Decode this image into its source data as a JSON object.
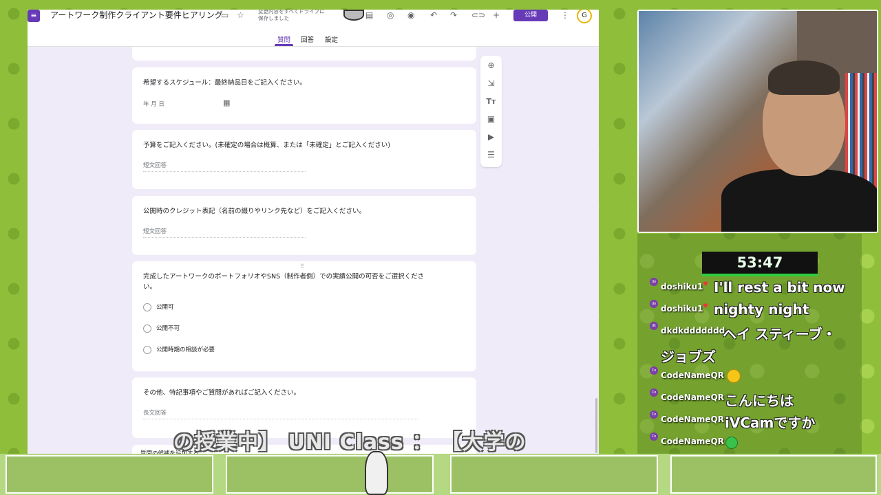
{
  "forms": {
    "title": "アートワーク制作クライアント要件ヒアリング",
    "save_status_line1": "変更内容をすべてドライブに",
    "save_status_line2": "保存しました",
    "publish_label": "公開",
    "avatar_letter": "G",
    "tabs": [
      "質問",
      "回答",
      "設定"
    ],
    "questions": {
      "schedule_title": "希望するスケジュール：最終納品日をご記入ください。",
      "schedule_placeholder": "年 月 日",
      "budget_title": "予算をご記入ください。(未確定の場合は概算、または「未確定」とご記入ください)",
      "budget_placeholder": "短文回答",
      "credit_title": "公開時のクレジット表記（名前の綴りやリンク先など）をご記入ください。",
      "credit_placeholder": "短文回答",
      "portfolio_title_line1": "完成したアートワークのポートフォリオやSNS（制作者側）での実績公開の可否をご選択くださ",
      "portfolio_title_line2": "い。",
      "portfolio_options": [
        "公開可",
        "公開不可",
        "公開時期の相談が必要"
      ],
      "other_title": "その他、特記事項やご質問があればご記入ください。",
      "other_placeholder": "長文回答",
      "bottom_hint": "質問の候補を追加する"
    },
    "toolbar_icons": [
      "add-question-icon",
      "import-questions-icon",
      "add-title-icon",
      "add-image-icon",
      "add-video-icon",
      "add-section-icon"
    ]
  },
  "overlay_ticker": "の授業中】 UNI Class ： 【大学の",
  "timer": "53:47",
  "chat": [
    {
      "user": "doshiku1",
      "msg": "I'll rest a bit now",
      "badge": "do",
      "heart": true
    },
    {
      "user": "doshiku1",
      "msg": "nighty night",
      "badge": "do",
      "heart": true
    },
    {
      "user": "dkdkddddddd",
      "msg": "ヘイ スティーブ・",
      "msg2": "ジョブズ",
      "badge": "dk",
      "heart": false
    },
    {
      "user": "CodeNameQR",
      "msg": "",
      "badge": "Co",
      "heart": false,
      "emoji": "grinning-face"
    },
    {
      "user": "CodeNameQR",
      "msg": "こんにちは",
      "badge": "Co",
      "heart": false
    },
    {
      "user": "CodeNameQR",
      "msg": "iVCamですか",
      "badge": "Co",
      "heart": false
    },
    {
      "user": "CodeNameQR",
      "msg": "",
      "badge": "Co",
      "heart": false,
      "emoji": "green-face"
    }
  ]
}
